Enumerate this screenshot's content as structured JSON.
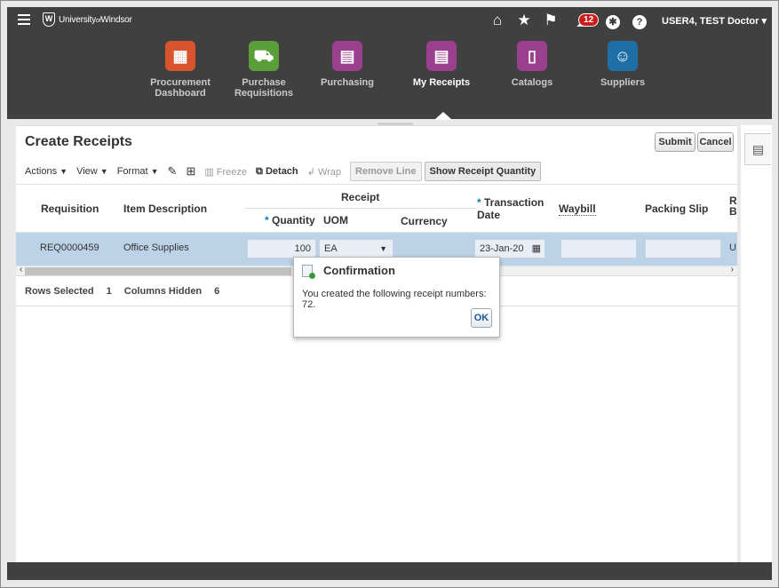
{
  "header": {
    "org_name": "University",
    "org_suffix": "of",
    "org_name2": "Windsor",
    "notification_count": "12",
    "user_label": "USER4, TEST Doctor ▾"
  },
  "apps": [
    {
      "label": "Procurement Dashboard",
      "icon": "dashboard-icon",
      "color": "#d9532c"
    },
    {
      "label": "Purchase Requisitions",
      "icon": "cart-icon",
      "color": "#5a9e3a"
    },
    {
      "label": "Purchasing",
      "icon": "document-icon",
      "color": "#9b3f8f"
    },
    {
      "label": "My Receipts",
      "icon": "receipt-icon",
      "color": "#9b3f8f"
    },
    {
      "label": "Catalogs",
      "icon": "catalog-icon",
      "color": "#9b3f8f"
    },
    {
      "label": "Suppliers",
      "icon": "suppliers-icon",
      "color": "#1d6fa6"
    }
  ],
  "page": {
    "title": "Create Receipts",
    "submit_label": "Submit",
    "cancel_label": "Cancel"
  },
  "toolbar": {
    "actions": "Actions",
    "view": "View",
    "format": "Format",
    "freeze": "Freeze",
    "detach": "Detach",
    "wrap": "Wrap",
    "remove_line": "Remove Line",
    "show_receipt_qty": "Show Receipt Quantity"
  },
  "table": {
    "headers": {
      "requisition": "Requisition",
      "item_description": "Item Description",
      "receipt_group": "Receipt",
      "quantity": "Quantity",
      "uom": "UOM",
      "currency": "Currency",
      "transaction": "Transaction",
      "date": "Date",
      "waybill": "Waybill",
      "packing_slip": "Packing Slip",
      "r_cut": "R",
      "b_cut": "B"
    },
    "row": {
      "requisition": "REQ0000459",
      "item_description": "Office Supplies",
      "quantity": "100",
      "uom": "EA",
      "transaction_date": "23-Jan-20",
      "trailing": "U"
    }
  },
  "status": {
    "rows_selected_label": "Rows Selected",
    "rows_selected_value": "1",
    "columns_hidden_label": "Columns Hidden",
    "columns_hidden_value": "6"
  },
  "dialog": {
    "title": "Confirmation",
    "message": "You created the following receipt numbers: 72.",
    "ok_label": "OK"
  }
}
